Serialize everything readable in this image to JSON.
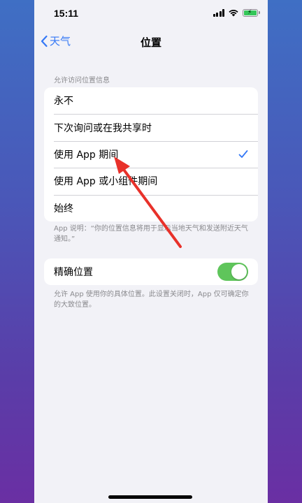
{
  "status_bar": {
    "time": "15:11",
    "battery_level_percent": 100,
    "battery_color": "#34c759"
  },
  "nav": {
    "back_label": "天气",
    "title": "位置",
    "accent_color": "#3478f6"
  },
  "location_access": {
    "header": "允许访问位置信息",
    "options": [
      {
        "label": "永不",
        "selected": false
      },
      {
        "label": "下次询问或在我共享时",
        "selected": false
      },
      {
        "label": "使用 App 期间",
        "selected": true
      },
      {
        "label": "使用 App 或小组件期间",
        "selected": false
      },
      {
        "label": "始终",
        "selected": false
      }
    ],
    "footnote": "App 说明：“你的位置信息将用于显示当地天气和发送附近天气通知。”"
  },
  "precise_location": {
    "label": "精确位置",
    "enabled": true,
    "toggle_color": "#5fc55b",
    "footnote": "允许 App 使用你的具体位置。此设置关闭时，App 仅可确定你的大致位置。"
  },
  "annotation": {
    "icon": "red-arrow",
    "color": "#e8312a"
  }
}
